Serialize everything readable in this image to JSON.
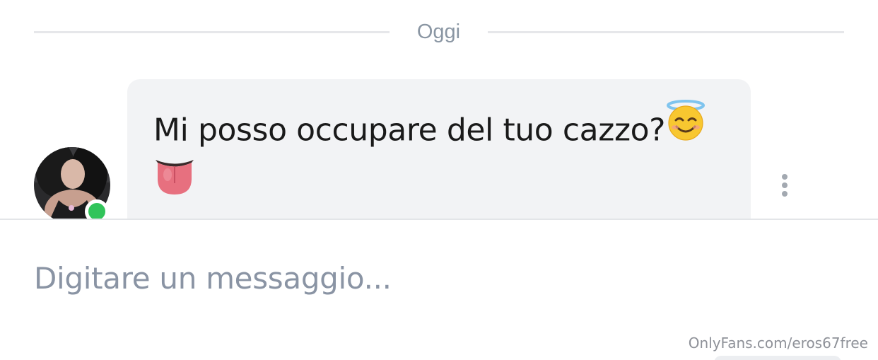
{
  "chat": {
    "date_divider": "Oggi",
    "message": {
      "text": "Mi posso occupare del tuo cazzo?",
      "emojis": [
        "smiling-face-with-halo-emoji",
        "tongue-emoji"
      ],
      "sender_online": true
    }
  },
  "composer": {
    "placeholder": "Digitare un messaggio..."
  },
  "watermark": "OnlyFans.com/eros67free",
  "colors": {
    "bubble": "#f2f3f5",
    "online": "#31c45a",
    "muted": "#8a96a3"
  }
}
